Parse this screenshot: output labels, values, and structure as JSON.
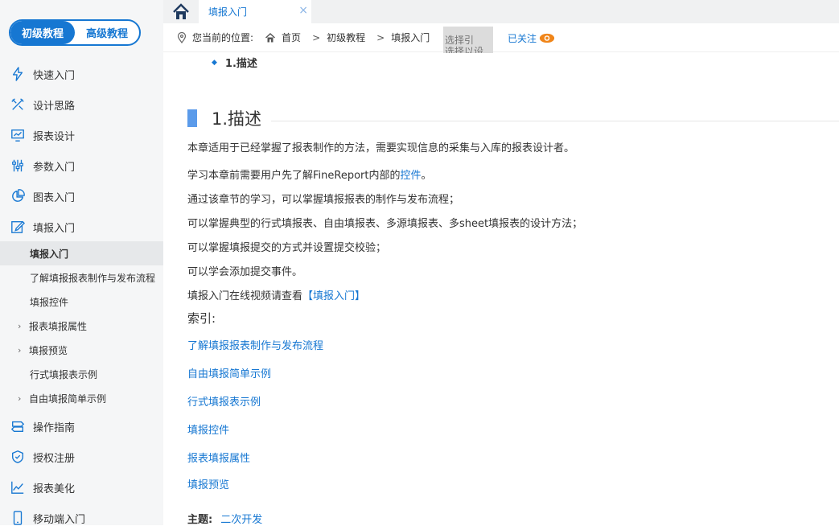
{
  "level_switch": {
    "basic": "初级教程",
    "advanced": "高级教程"
  },
  "sidebar": {
    "items": [
      {
        "label": "快速入门",
        "icon": "lightning-icon"
      },
      {
        "label": "设计思路",
        "icon": "tools-icon"
      },
      {
        "label": "报表设计",
        "icon": "monitor-chart-icon"
      },
      {
        "label": "参数入门",
        "icon": "sliders-icon"
      },
      {
        "label": "图表入门",
        "icon": "pie-chart-icon"
      },
      {
        "label": "填报入门",
        "icon": "edit-icon"
      }
    ],
    "sub_items": [
      {
        "label": "填报入门",
        "active": true,
        "chevron": false
      },
      {
        "label": "了解填报报表制作与发布流程",
        "active": false,
        "chevron": false
      },
      {
        "label": "填报控件",
        "active": false,
        "chevron": false
      },
      {
        "label": "报表填报属性",
        "active": false,
        "chevron": true
      },
      {
        "label": "填报预览",
        "active": false,
        "chevron": true
      },
      {
        "label": "行式填报表示例",
        "active": false,
        "chevron": false
      },
      {
        "label": "自由填报简单示例",
        "active": false,
        "chevron": true
      }
    ],
    "items_after": [
      {
        "label": "操作指南",
        "icon": "signpost-icon"
      },
      {
        "label": "授权注册",
        "icon": "shield-check-icon"
      },
      {
        "label": "报表美化",
        "icon": "line-chart-icon"
      },
      {
        "label": "移动端入门",
        "icon": "mobile-icon"
      }
    ]
  },
  "tabs": {
    "active_label": "填报入门",
    "close": "×"
  },
  "breadcrumb": {
    "prefix": "您当前的位置:",
    "items": [
      "首页",
      "初级教程",
      "填报入门"
    ],
    "sep": ">"
  },
  "overlay_text": [
    "选择引",
    "选择以设"
  ],
  "follow_label": "已关注",
  "toc_item": "1.描述",
  "heading": "1.描述",
  "paragraphs": {
    "p1": "本章适用于已经掌握了报表制作的方法，需要实现信息的采集与入库的报表设计者。",
    "p2_before": "学习本章前需要用户先了解FineReport内部的",
    "p2_link": "控件",
    "p2_after": "。",
    "p3": "通过该章节的学习，可以掌握填报报表的制作与发布流程；",
    "p4": "可以掌握典型的行式填报表、自由填报表、多源填报表、多sheet填报表的设计方法；",
    "p5": "可以掌握填报提交的方式并设置提交校验；",
    "p6": "可以学会添加提交事件。",
    "p7_before": "填报入门在线视频请查看",
    "p7_link": "【填报入门】"
  },
  "index_label": "索引:",
  "index_links": [
    "了解填报报表制作与发布流程",
    "自由填报简单示例",
    "行式填报表示例",
    "填报控件",
    "报表填报属性",
    "填报预览"
  ],
  "topic": {
    "label": "主题:",
    "value": "二次开发"
  },
  "colors": {
    "accent": "#1677d2",
    "follow_eye": "#f08519",
    "heading_bar": "#5b9bea"
  }
}
